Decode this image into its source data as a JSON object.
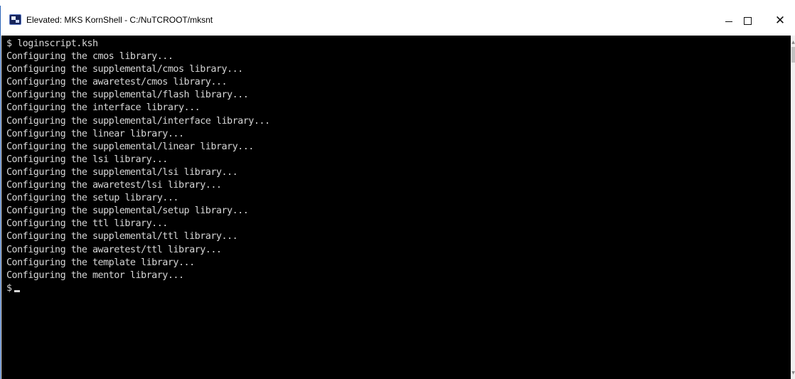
{
  "window": {
    "title": "Elevated: MKS KornShell - C:/NuTCROOT/mksnt",
    "icon": "console-app-icon",
    "controls": {
      "minimize_icon": "minimize-icon",
      "maximize_icon": "maximize-icon",
      "close_glyph": "✕"
    }
  },
  "console": {
    "lines": [
      "$ loginscript.ksh",
      "Configuring the cmos library...",
      "Configuring the supplemental/cmos library...",
      "Configuring the awaretest/cmos library...",
      "Configuring the supplemental/flash library...",
      "Configuring the interface library...",
      "Configuring the supplemental/interface library...",
      "Configuring the linear library...",
      "Configuring the supplemental/linear library...",
      "Configuring the lsi library...",
      "Configuring the supplemental/lsi library...",
      "Configuring the awaretest/lsi library...",
      "Configuring the setup library...",
      "Configuring the supplemental/setup library...",
      "Configuring the ttl library...",
      "Configuring the supplemental/ttl library...",
      "Configuring the awaretest/ttl library...",
      "Configuring the template library...",
      "Configuring the mentor library..."
    ],
    "prompt": "$"
  },
  "colors": {
    "console_background": "#000000",
    "console_text": "#d6d6d6",
    "window_border": "#2a63b8"
  }
}
